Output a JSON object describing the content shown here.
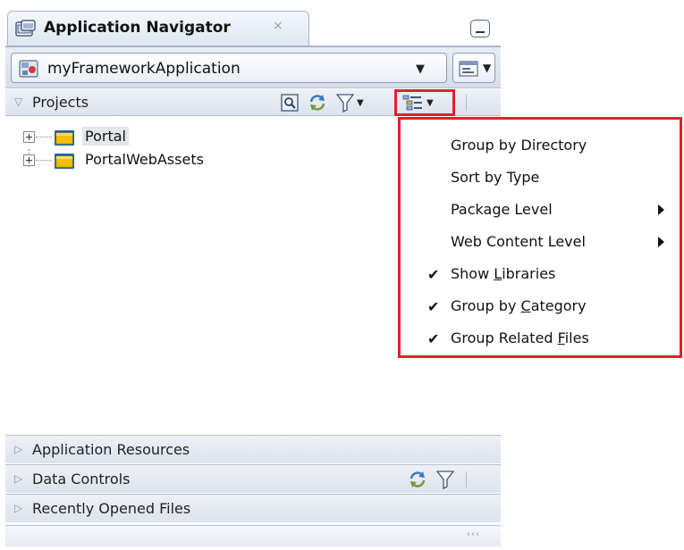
{
  "tab": {
    "title": "Application Navigator",
    "close_label": "×",
    "icon": "application-navigator-icon"
  },
  "app_selector": {
    "value": "myFrameworkApplication",
    "icon": "application-icon"
  },
  "projects_panel": {
    "label": "Projects",
    "toolbar_icons": [
      "search-icon",
      "refresh-icon",
      "filter-icon",
      "navigator-display-options-icon"
    ]
  },
  "tree": {
    "items": [
      {
        "label": "Portal",
        "selected": true
      },
      {
        "label": "PortalWebAssets",
        "selected": false
      }
    ]
  },
  "accordions": [
    {
      "label": "Application Resources"
    },
    {
      "label": "Data Controls"
    },
    {
      "label": "Recently Opened Files"
    }
  ],
  "menu": {
    "items": [
      {
        "label": "Group by Directory",
        "checked": false,
        "submenu": false
      },
      {
        "label": "Sort by Type",
        "checked": false,
        "submenu": false
      },
      {
        "label": "Package Level",
        "checked": false,
        "submenu": true
      },
      {
        "label": "Web Content Level",
        "checked": false,
        "submenu": true
      },
      {
        "label_pre": "Show ",
        "mnemonic": "L",
        "label_post": "ibraries",
        "checked": true,
        "submenu": false
      },
      {
        "label_pre": "Group by ",
        "mnemonic": "C",
        "label_post": "ategory",
        "checked": true,
        "submenu": false
      },
      {
        "label_pre": "Group Related ",
        "mnemonic": "F",
        "label_post": "iles",
        "checked": true,
        "submenu": false
      }
    ]
  },
  "colors": {
    "highlight": "#e0212a",
    "folder": "#f2c200",
    "header_gradient_top": "#eef1f6"
  }
}
